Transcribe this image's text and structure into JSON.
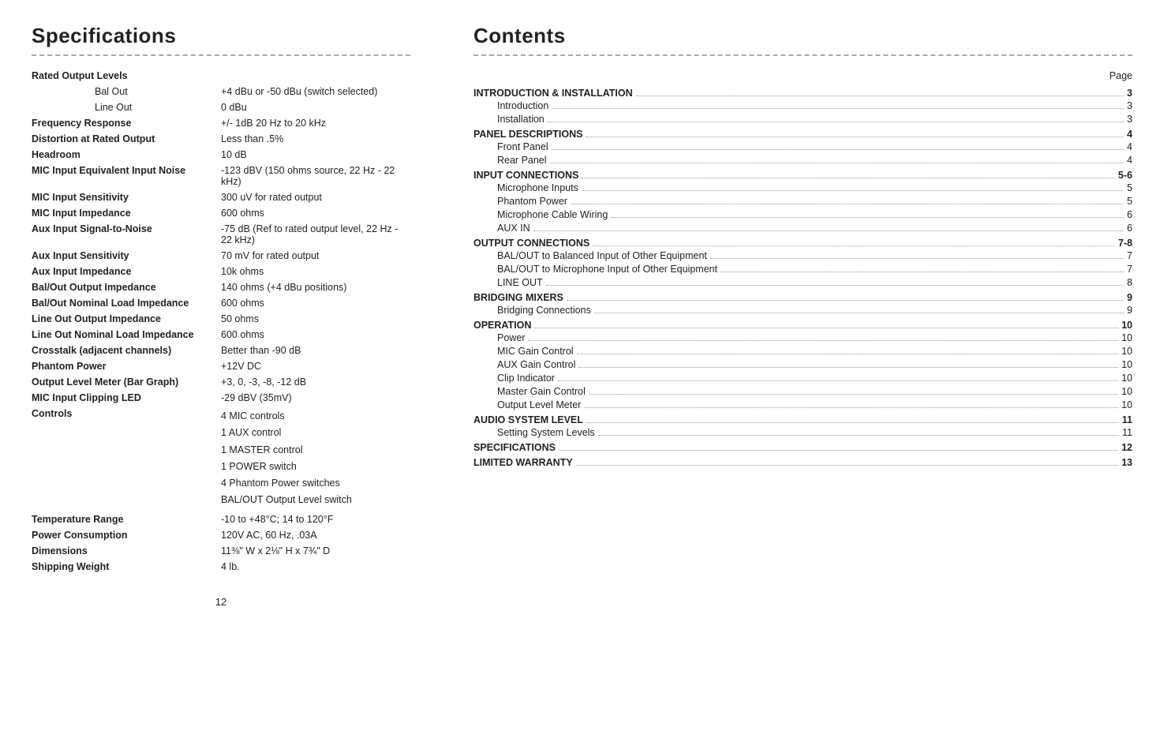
{
  "left": {
    "title": "Specifications",
    "specs": [
      {
        "label": "Rated Output Levels",
        "value": "",
        "isHeader": true
      },
      {
        "label": "Bal Out",
        "value": "+4 dBu or -50 dBu (switch selected)",
        "isSub": true
      },
      {
        "label": "Line Out",
        "value": "0 dBu",
        "isSub": true
      },
      {
        "label": "Frequency Response",
        "value": "+/- 1dB 20 Hz to 20 kHz"
      },
      {
        "label": "Distortion at Rated Output",
        "value": "Less than .5%"
      },
      {
        "label": "Headroom",
        "value": "10 dB"
      },
      {
        "label": "MIC Input Equivalent Input Noise",
        "value": "-123 dBV (150 ohms source, 22 Hz - 22 kHz)"
      },
      {
        "label": "MIC Input Sensitivity",
        "value": "300 uV for rated output"
      },
      {
        "label": "MIC Input Impedance",
        "value": "600 ohms"
      },
      {
        "label": "Aux Input Signal-to-Noise",
        "value": "-75 dB  (Ref to rated output level, 22 Hz - 22 kHz)"
      },
      {
        "label": "Aux Input Sensitivity",
        "value": "70 mV for rated output"
      },
      {
        "label": "Aux Input Impedance",
        "value": "10k ohms"
      },
      {
        "label": "Bal/Out Output Impedance",
        "value": "140 ohms (+4 dBu positions)"
      },
      {
        "label": "Bal/Out Nominal Load Impedance",
        "value": "600 ohms"
      },
      {
        "label": "Line Out Output Impedance",
        "value": "50 ohms"
      },
      {
        "label": "Line Out Nominal Load Impedance",
        "value": "600 ohms"
      },
      {
        "label": "Crosstalk (adjacent channels)",
        "value": "Better than -90 dB"
      },
      {
        "label": "Phantom Power",
        "value": "+12V DC"
      },
      {
        "label": "Output Level Meter (Bar Graph)",
        "value": "+3, 0, -3, -8, -12 dB"
      },
      {
        "label": "MIC Input Clipping LED",
        "value": "-29 dBV  (35mV)"
      },
      {
        "label": "Controls",
        "value": "4 MIC controls\n1 AUX control\n1 MASTER control\n1 POWER switch\n4 Phantom Power switches\nBAL/OUT Output Level switch",
        "isMulti": true
      },
      {
        "label": "Temperature Range",
        "value": "-10 to +48°C; 14 to 120°F"
      },
      {
        "label": "Power Consumption",
        "value": "120V AC, 60 Hz, .03A"
      },
      {
        "label": "Dimensions",
        "value": "11⅜\" W x 2⅛\" H x 7¾\" D"
      },
      {
        "label": "Shipping Weight",
        "value": "4 lb."
      }
    ],
    "pageNum": "12"
  },
  "right": {
    "title": "Contents",
    "pageLabel": "Page",
    "entries": [
      {
        "label": "INTRODUCTION & INSTALLATION",
        "page": "3",
        "isMain": true
      },
      {
        "label": "Introduction",
        "page": "3",
        "isSub": true
      },
      {
        "label": "Installation",
        "page": "3",
        "isSub": true
      },
      {
        "label": "PANEL DESCRIPTIONS",
        "page": "4",
        "isMain": true
      },
      {
        "label": "Front Panel",
        "page": "4",
        "isSub": true
      },
      {
        "label": "Rear Panel",
        "page": "4",
        "isSub": true
      },
      {
        "label": "INPUT CONNECTIONS",
        "page": "5-6",
        "isMain": true
      },
      {
        "label": "Microphone Inputs",
        "page": "5",
        "isSub": true
      },
      {
        "label": "Phantom Power",
        "page": "5",
        "isSub": true
      },
      {
        "label": "Microphone Cable Wiring",
        "page": "6",
        "isSub": true
      },
      {
        "label": "AUX IN",
        "page": "6",
        "isSub": true
      },
      {
        "label": "OUTPUT CONNECTIONS",
        "page": "7-8",
        "isMain": true
      },
      {
        "label": "BAL/OUT to Balanced Input of Other Equipment",
        "page": "7",
        "isSub": true
      },
      {
        "label": "BAL/OUT to Microphone Input of Other Equipment",
        "page": "7",
        "isSub": true
      },
      {
        "label": "LINE OUT",
        "page": "8",
        "isSub": true
      },
      {
        "label": "BRIDGING MIXERS",
        "page": "9",
        "isMain": true
      },
      {
        "label": "Bridging Connections",
        "page": "9",
        "isSub": true
      },
      {
        "label": "OPERATION",
        "page": "10",
        "isMain": true
      },
      {
        "label": "Power",
        "page": "10",
        "isSub": true
      },
      {
        "label": "MIC Gain Control",
        "page": "10",
        "isSub": true
      },
      {
        "label": "AUX Gain Control",
        "page": "10",
        "isSub": true
      },
      {
        "label": "Clip Indicator",
        "page": "10",
        "isSub": true
      },
      {
        "label": "Master Gain Control",
        "page": "10",
        "isSub": true
      },
      {
        "label": "Output Level Meter",
        "page": "10",
        "isSub": true
      },
      {
        "label": "AUDIO SYSTEM LEVEL",
        "page": "11",
        "isMain": true
      },
      {
        "label": "Setting System Levels",
        "page": "11",
        "isSub": true
      },
      {
        "label": "SPECIFICATIONS",
        "page": "12",
        "isMain": true
      },
      {
        "label": "LIMITED WARRANTY",
        "page": "13",
        "isMain": true
      }
    ]
  }
}
